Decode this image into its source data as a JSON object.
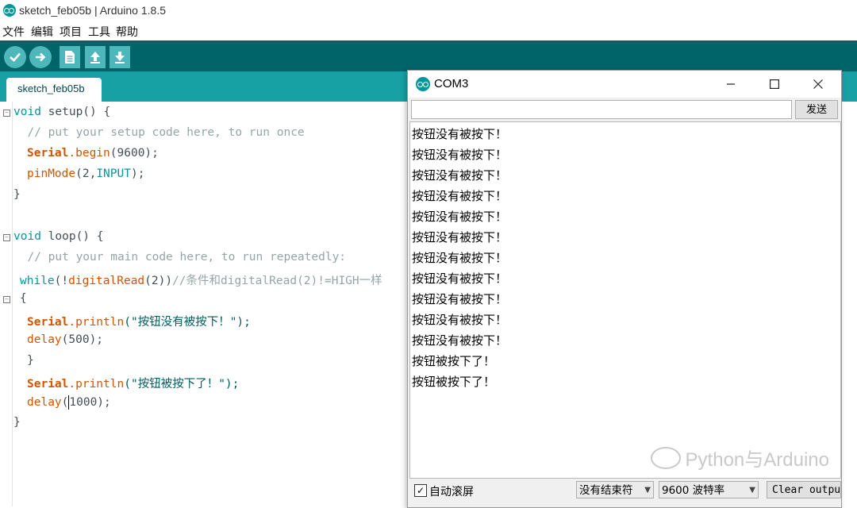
{
  "ide": {
    "title": "sketch_feb05b | Arduino 1.8.5",
    "menu": [
      "文件",
      "编辑",
      "项目",
      "工具",
      "帮助"
    ],
    "toolbar_icons": [
      "verify-icon",
      "upload-icon",
      "new-icon",
      "open-icon",
      "save-icon"
    ],
    "tab_label": "sketch_feb05b",
    "code": {
      "l1": {
        "kw": "void",
        "name": " setup() {"
      },
      "l2": "  // put your setup code here, to run once",
      "l3": {
        "obj": "Serial",
        "fn": ".begin",
        "rest": "(9600);"
      },
      "l4": {
        "fn": "pinMode",
        "a": "(2,",
        "const": "INPUT",
        "b": ");"
      },
      "l5": "}",
      "l7": {
        "kw": "void",
        "name": " loop() {"
      },
      "l8": "  // put your main code here, to run repeatedly:",
      "l9": {
        "kw": "while",
        "a": "(!",
        "fn": "digitalRead",
        "b": "(2))",
        "cm": "//条件和digitalRead(2)!=HIGH一样"
      },
      "l10": "{",
      "l11": {
        "obj": "Serial",
        "fn": ".println",
        "str": "(\"按钮没有被按下！\");"
      },
      "l12": {
        "fn": "delay",
        "rest": "(500);"
      },
      "l13": "}",
      "l14": {
        "obj": "Serial",
        "fn": ".println",
        "str": "(\"按钮被按下了！\");"
      },
      "l15": {
        "fn": "delay",
        "a": "(",
        "rest": "1000);"
      },
      "l16": "}"
    }
  },
  "monitor": {
    "title": "COM3",
    "send_label": "发送",
    "output_lines": [
      "按钮没有被按下！",
      "按钮没有被按下！",
      "按钮没有被按下！",
      "按钮没有被按下！",
      "按钮没有被按下！",
      "按钮没有被按下！",
      "按钮没有被按下！",
      "按钮没有被按下！",
      "按钮没有被按下！",
      "按钮没有被按下！",
      "按钮没有被按下！",
      "按钮被按下了！",
      "按钮被按下了！"
    ],
    "autoscroll_label": "自动滚屏",
    "autoscroll_checked": true,
    "line_ending": "没有结束符",
    "baud": "9600 波特率",
    "clear_label": "Clear output",
    "watermark": "Python与Arduino"
  }
}
